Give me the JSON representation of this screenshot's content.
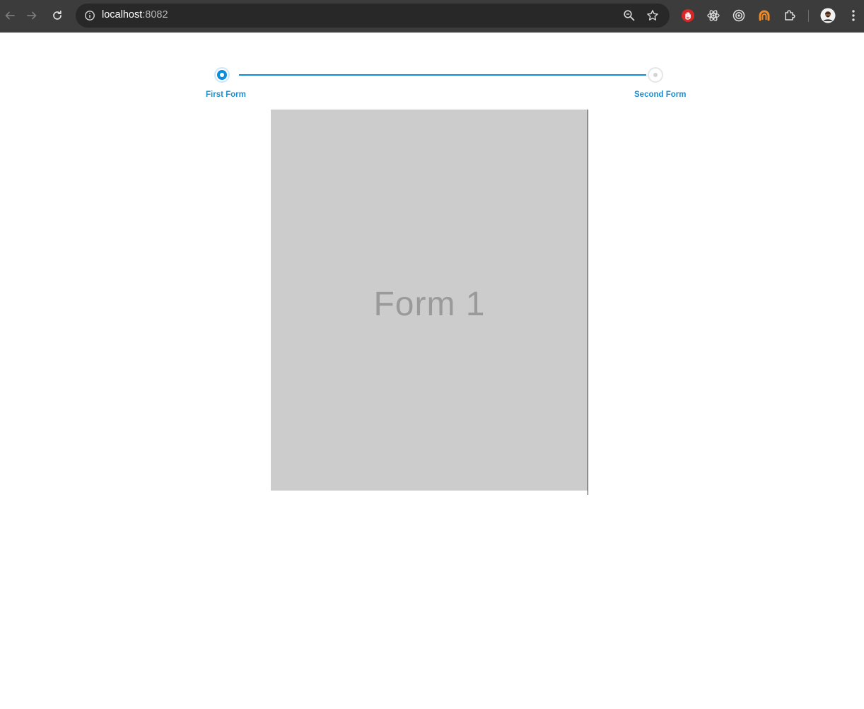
{
  "browser": {
    "url_host": "localhost",
    "url_port": ":8082",
    "icons": {
      "back": "arrow-left-icon",
      "forward": "arrow-right-icon",
      "reload": "reload-icon",
      "site_info": "info-icon",
      "zoom": "zoom-icon",
      "bookmark": "star-icon",
      "extensions": [
        "hand-stop-icon",
        "react-icon",
        "target-icon",
        "orange-arc-icon",
        "puzzle-icon"
      ],
      "menu": "kebab-menu-icon"
    }
  },
  "stepper": {
    "steps": [
      {
        "label": "First Form",
        "state": "active"
      },
      {
        "label": "Second Form",
        "state": "inactive"
      }
    ],
    "accent_color": "#0a8fe0"
  },
  "form": {
    "title": "Form 1"
  }
}
